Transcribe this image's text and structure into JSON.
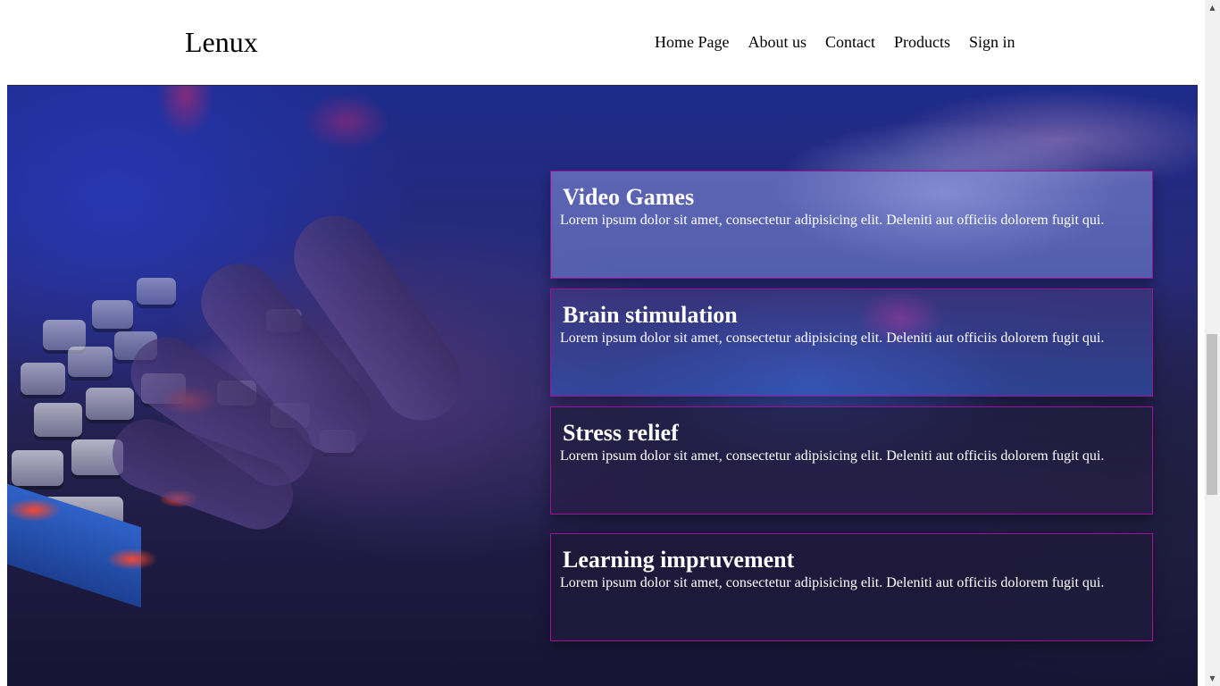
{
  "header": {
    "logo": "Lenux",
    "nav": [
      "Home Page",
      "About us",
      "Contact",
      "Products",
      "Sign in"
    ]
  },
  "cards": [
    {
      "title": "Video Games",
      "text": "Lorem ipsum dolor sit amet, consectetur adipisicing elit. Deleniti aut officiis dolorem fugit qui."
    },
    {
      "title": "Brain stimulation",
      "text": "Lorem ipsum dolor sit amet, consectetur adipisicing elit. Deleniti aut officiis dolorem fugit qui."
    },
    {
      "title": "Stress relief",
      "text": "Lorem ipsum dolor sit amet, consectetur adipisicing elit. Deleniti aut officiis dolorem fugit qui."
    },
    {
      "title": "Learning impruvement",
      "text": "Lorem ipsum dolor sit amet, consectetur adipisicing elit. Deleniti aut officiis dolorem fugit qui."
    }
  ],
  "scrollbar": {
    "up_icon": "▲",
    "down_icon": "▼"
  },
  "colors": {
    "card_border": "#a0129c",
    "header_bg": "#ffffff"
  }
}
